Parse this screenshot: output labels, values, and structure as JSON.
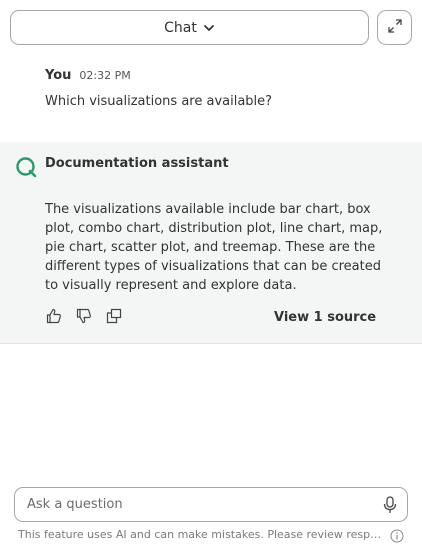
{
  "header": {
    "mode_label": "Chat",
    "chevron_icon": "chevron-down-icon",
    "expand_icon": "expand-icon"
  },
  "conversation": {
    "user_message": {
      "author": "You",
      "time": "02:32 PM",
      "text": "Which visualizations are available?"
    },
    "assistant_message": {
      "author": "Documentation assistant",
      "text": "The visualizations available include bar chart, box plot, combo chart, distribution plot, line chart, map, pie chart, scatter plot, and treemap. These are the different types of visualizations that can be created to visually represent and explore data.",
      "view_source_label": "View 1 source",
      "actions": [
        "thumbs-up-icon",
        "thumbs-down-icon",
        "copy-icon"
      ]
    }
  },
  "composer": {
    "placeholder": "Ask a question",
    "mic_icon": "microphone-icon",
    "disclaimer": "This feature uses AI and can make mistakes. Please review responses.",
    "info_icon": "info-icon"
  },
  "colors": {
    "assistant_bg": "#f3f6f5",
    "brand_green": "#2b9a6e",
    "border": "#a7a7a7"
  }
}
